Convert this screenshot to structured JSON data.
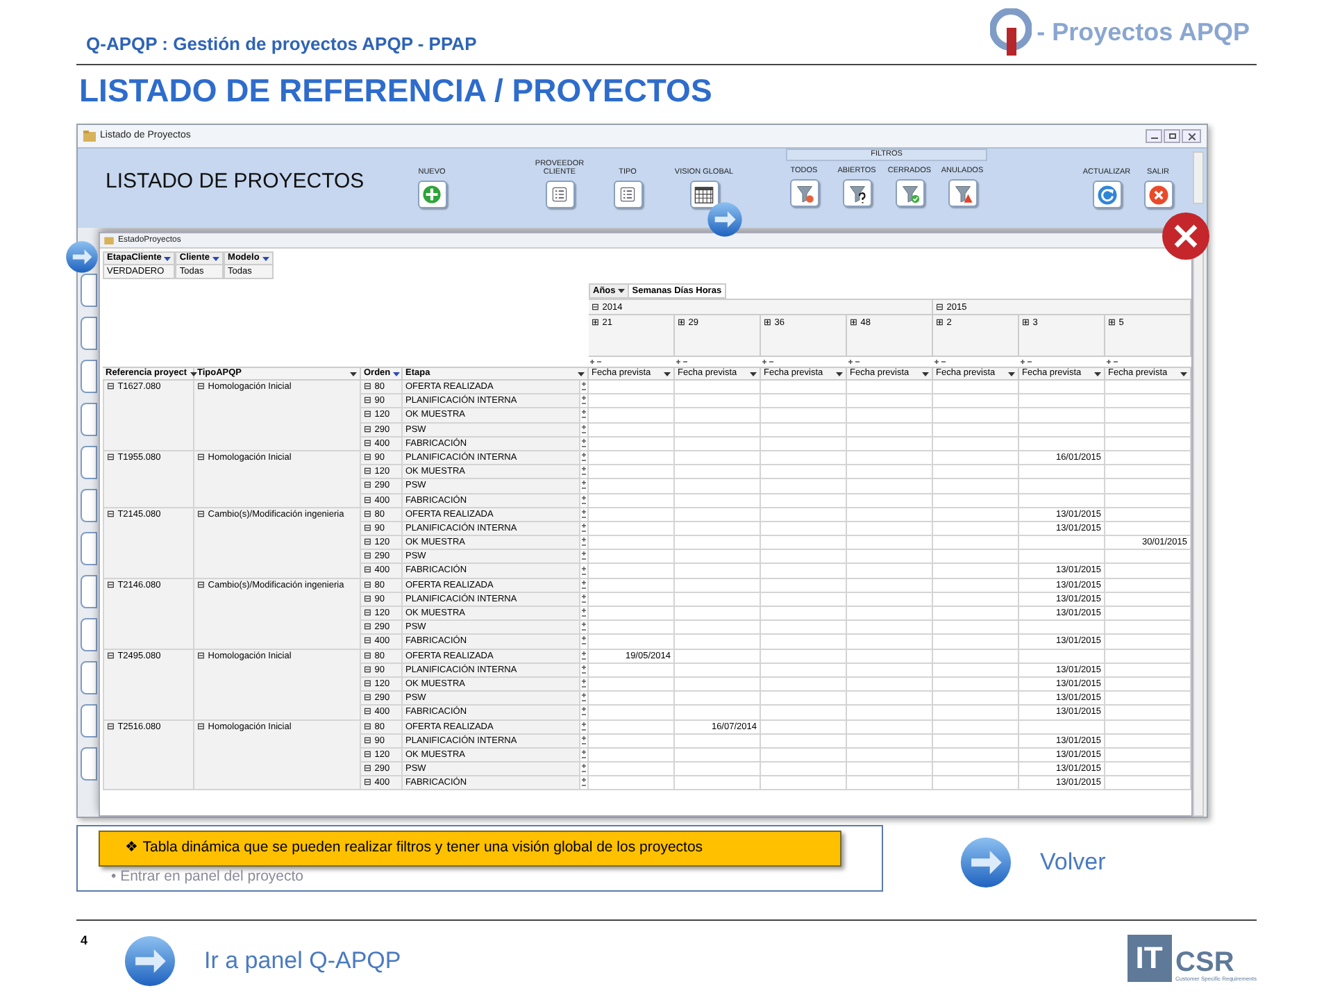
{
  "slide": {
    "header": "Q-APQP : Gestión de proyectos APQP - PPAP",
    "logo_text": "- Proyectos APQP",
    "title": "LISTADO DE REFERENCIA / PROYECTOS",
    "page_number": "4"
  },
  "window": {
    "title": "Listado de Proyectos",
    "heading": "LISTADO DE PROYECTOS",
    "toolbar": [
      {
        "label": "NUEVO",
        "kind": "add"
      },
      {
        "label": "PROVEEDOR CLIENTE",
        "kind": "list"
      },
      {
        "label": "TIPO",
        "kind": "list"
      },
      {
        "label": "VISION GLOBAL",
        "kind": "calendar"
      }
    ],
    "filters": {
      "title": "FILTROS",
      "buttons": [
        {
          "label": "TODOS",
          "kind": "filter-all"
        },
        {
          "label": "ABIERTOS",
          "kind": "filter-open"
        },
        {
          "label": "CERRADOS",
          "kind": "filter-closed"
        },
        {
          "label": "ANULADOS",
          "kind": "filter-cancelled"
        }
      ]
    },
    "right_buttons": [
      {
        "label": "ACTUALIZAR",
        "kind": "refresh"
      },
      {
        "label": "SALIR",
        "kind": "exit"
      }
    ]
  },
  "inner_window": {
    "title": "EstadoProyectos"
  },
  "pivot": {
    "page_filters": [
      {
        "label": "EtapaCliente",
        "value": "VERDADERO"
      },
      {
        "label": "Cliente",
        "value": "Todas"
      },
      {
        "label": "Modelo",
        "value": "Todas"
      }
    ],
    "time_field": "Años",
    "time_options": "Semanas Días Horas",
    "years": [
      {
        "label": "⊟ 2014",
        "weeks": [
          {
            "label": "⊞ 21",
            "value_header": "Fecha prevista"
          },
          {
            "label": "⊞ 29",
            "value_header": "Fecha prevista"
          },
          {
            "label": "⊞ 36",
            "value_header": "Fecha prevista"
          },
          {
            "label": "⊞ 48",
            "value_header": "Fecha prevista"
          }
        ]
      },
      {
        "label": "⊟ 2015",
        "weeks": [
          {
            "label": "⊞ 2",
            "value_header": "Fecha prevista"
          },
          {
            "label": "⊞ 3",
            "value_header": "Fecha prevista"
          },
          {
            "label": "⊞ 5",
            "value_header": "Fecha prevista"
          }
        ]
      }
    ],
    "row_headers": [
      "Referencia proyect",
      "TipoAPQP",
      "Orden",
      "Etapa"
    ],
    "projects": [
      {
        "ref": "⊟ T1627.080",
        "tipo": "⊟ Homologación Inicial",
        "stages": [
          {
            "orden": "⊟ 80",
            "etapa": "OFERTA REALIZADA",
            "dates": [
              {
                "kind": "blank"
              },
              {
                "kind": "blank"
              },
              {
                "kind": "blank"
              },
              {
                "kind": "blank"
              },
              {
                "kind": "blank"
              },
              {
                "kind": "blank"
              },
              {
                "kind": "blank"
              }
            ]
          },
          {
            "orden": "⊟ 90",
            "etapa": "PLANIFICACIÓN INTERNA",
            "dates": [
              {
                "kind": "blank"
              },
              {
                "kind": "blank"
              },
              {
                "kind": "blank"
              },
              {
                "kind": "blank"
              },
              {
                "kind": "blank"
              },
              {
                "kind": "blank"
              },
              {
                "kind": "blank"
              }
            ]
          },
          {
            "orden": "⊟ 120",
            "etapa": "OK MUESTRA",
            "dates": [
              {
                "kind": "blank"
              },
              {
                "kind": "blank"
              },
              {
                "kind": "blank"
              },
              {
                "kind": "blank"
              },
              {
                "kind": "blank"
              },
              {
                "kind": "blank"
              },
              {
                "kind": "blank"
              }
            ]
          },
          {
            "orden": "⊟ 290",
            "etapa": "PSW",
            "dates": [
              {
                "kind": "blank"
              },
              {
                "kind": "blank"
              },
              {
                "kind": "blank"
              },
              {
                "kind": "blank"
              },
              {
                "kind": "blank"
              },
              {
                "kind": "blank"
              },
              {
                "kind": "blank"
              }
            ]
          },
          {
            "orden": "⊟ 400",
            "etapa": "FABRICACIÓN",
            "dates": [
              {
                "kind": "blank"
              },
              {
                "kind": "blank"
              },
              {
                "kind": "blank"
              },
              {
                "kind": "blank"
              },
              {
                "kind": "blank"
              },
              {
                "kind": "blank"
              },
              {
                "kind": "blank"
              }
            ]
          }
        ]
      },
      {
        "ref": "⊟ T1955.080",
        "tipo": "⊟ Homologación Inicial",
        "stages": [
          {
            "orden": "⊟ 90",
            "etapa": "PLANIFICACIÓN INTERNA",
            "dates": [
              {
                "kind": "blank"
              },
              {
                "kind": "blank"
              },
              {
                "kind": "blank"
              },
              {
                "kind": "blank"
              },
              {
                "kind": "blank"
              },
              {
                "kind": "date",
                "text": "16/01/2015"
              },
              {
                "kind": "blank"
              }
            ]
          },
          {
            "orden": "⊟ 120",
            "etapa": "OK MUESTRA",
            "dates": [
              {
                "kind": "blank"
              },
              {
                "kind": "blank"
              },
              {
                "kind": "blank"
              },
              {
                "kind": "blank"
              },
              {
                "kind": "blank"
              },
              {
                "kind": "blank"
              },
              {
                "kind": "blank"
              }
            ]
          },
          {
            "orden": "⊟ 290",
            "etapa": "PSW",
            "dates": [
              {
                "kind": "blank"
              },
              {
                "kind": "blank"
              },
              {
                "kind": "blank"
              },
              {
                "kind": "blank"
              },
              {
                "kind": "blank"
              },
              {
                "kind": "blank"
              },
              {
                "kind": "blank"
              }
            ]
          },
          {
            "orden": "⊟ 400",
            "etapa": "FABRICACIÓN",
            "dates": [
              {
                "kind": "blank"
              },
              {
                "kind": "blank"
              },
              {
                "kind": "blank"
              },
              {
                "kind": "blank"
              },
              {
                "kind": "blank"
              },
              {
                "kind": "blank"
              },
              {
                "kind": "blank"
              }
            ]
          }
        ]
      },
      {
        "ref": "⊟ T2145.080",
        "tipo": "⊟ Cambio(s)/Modificación ingenieria",
        "stages": [
          {
            "orden": "⊟ 80",
            "etapa": "OFERTA REALIZADA",
            "dates": [
              {
                "kind": "blank"
              },
              {
                "kind": "blank"
              },
              {
                "kind": "blank"
              },
              {
                "kind": "blank"
              },
              {
                "kind": "blank"
              },
              {
                "kind": "date",
                "text": "13/01/2015"
              },
              {
                "kind": "blank"
              }
            ]
          },
          {
            "orden": "⊟ 90",
            "etapa": "PLANIFICACIÓN INTERNA",
            "dates": [
              {
                "kind": "blank"
              },
              {
                "kind": "blank"
              },
              {
                "kind": "blank"
              },
              {
                "kind": "blank"
              },
              {
                "kind": "blank"
              },
              {
                "kind": "date",
                "text": "13/01/2015"
              },
              {
                "kind": "blank"
              }
            ]
          },
          {
            "orden": "⊟ 120",
            "etapa": "OK MUESTRA",
            "dates": [
              {
                "kind": "blank"
              },
              {
                "kind": "blank"
              },
              {
                "kind": "blank"
              },
              {
                "kind": "blank"
              },
              {
                "kind": "blank"
              },
              {
                "kind": "blank"
              },
              {
                "kind": "date",
                "text": "30/01/2015"
              }
            ]
          },
          {
            "orden": "⊟ 290",
            "etapa": "PSW",
            "dates": [
              {
                "kind": "blank"
              },
              {
                "kind": "blank"
              },
              {
                "kind": "blank"
              },
              {
                "kind": "blank"
              },
              {
                "kind": "blank"
              },
              {
                "kind": "blank"
              },
              {
                "kind": "blank"
              }
            ]
          },
          {
            "orden": "⊟ 400",
            "etapa": "FABRICACIÓN",
            "dates": [
              {
                "kind": "blank"
              },
              {
                "kind": "blank"
              },
              {
                "kind": "blank"
              },
              {
                "kind": "blank"
              },
              {
                "kind": "blank"
              },
              {
                "kind": "date",
                "text": "13/01/2015"
              },
              {
                "kind": "blank"
              }
            ]
          }
        ]
      },
      {
        "ref": "⊟ T2146.080",
        "tipo": "⊟ Cambio(s)/Modificación ingenieria",
        "stages": [
          {
            "orden": "⊟ 80",
            "etapa": "OFERTA REALIZADA",
            "dates": [
              {
                "kind": "blank"
              },
              {
                "kind": "blank"
              },
              {
                "kind": "blank"
              },
              {
                "kind": "blank"
              },
              {
                "kind": "blank"
              },
              {
                "kind": "date",
                "text": "13/01/2015"
              },
              {
                "kind": "blank"
              }
            ]
          },
          {
            "orden": "⊟ 90",
            "etapa": "PLANIFICACIÓN INTERNA",
            "dates": [
              {
                "kind": "blank"
              },
              {
                "kind": "blank"
              },
              {
                "kind": "blank"
              },
              {
                "kind": "blank"
              },
              {
                "kind": "blank"
              },
              {
                "kind": "date",
                "text": "13/01/2015"
              },
              {
                "kind": "blank"
              }
            ]
          },
          {
            "orden": "⊟ 120",
            "etapa": "OK MUESTRA",
            "dates": [
              {
                "kind": "blank"
              },
              {
                "kind": "blank"
              },
              {
                "kind": "blank"
              },
              {
                "kind": "blank"
              },
              {
                "kind": "blank"
              },
              {
                "kind": "date",
                "text": "13/01/2015"
              },
              {
                "kind": "blank"
              }
            ]
          },
          {
            "orden": "⊟ 290",
            "etapa": "PSW",
            "dates": [
              {
                "kind": "blank"
              },
              {
                "kind": "blank"
              },
              {
                "kind": "blank"
              },
              {
                "kind": "blank"
              },
              {
                "kind": "blank"
              },
              {
                "kind": "blank"
              },
              {
                "kind": "blank"
              }
            ]
          },
          {
            "orden": "⊟ 400",
            "etapa": "FABRICACIÓN",
            "dates": [
              {
                "kind": "blank"
              },
              {
                "kind": "blank"
              },
              {
                "kind": "blank"
              },
              {
                "kind": "blank"
              },
              {
                "kind": "blank"
              },
              {
                "kind": "date",
                "text": "13/01/2015"
              },
              {
                "kind": "blank"
              }
            ]
          }
        ]
      },
      {
        "ref": "⊟ T2495.080",
        "tipo": "⊟ Homologación Inicial",
        "stages": [
          {
            "orden": "⊟ 80",
            "etapa": "OFERTA REALIZADA",
            "dates": [
              {
                "kind": "date",
                "text": "19/05/2014"
              },
              {
                "kind": "blank"
              },
              {
                "kind": "blank"
              },
              {
                "kind": "blank"
              },
              {
                "kind": "blank"
              },
              {
                "kind": "blank"
              },
              {
                "kind": "blank"
              }
            ]
          },
          {
            "orden": "⊟ 90",
            "etapa": "PLANIFICACIÓN INTERNA",
            "dates": [
              {
                "kind": "blank"
              },
              {
                "kind": "blank"
              },
              {
                "kind": "blank"
              },
              {
                "kind": "blank"
              },
              {
                "kind": "blank"
              },
              {
                "kind": "date",
                "text": "13/01/2015"
              },
              {
                "kind": "blank"
              }
            ]
          },
          {
            "orden": "⊟ 120",
            "etapa": "OK MUESTRA",
            "dates": [
              {
                "kind": "blank"
              },
              {
                "kind": "blank"
              },
              {
                "kind": "blank"
              },
              {
                "kind": "blank"
              },
              {
                "kind": "blank"
              },
              {
                "kind": "date",
                "text": "13/01/2015"
              },
              {
                "kind": "blank"
              }
            ]
          },
          {
            "orden": "⊟ 290",
            "etapa": "PSW",
            "dates": [
              {
                "kind": "blank"
              },
              {
                "kind": "blank"
              },
              {
                "kind": "blank"
              },
              {
                "kind": "blank"
              },
              {
                "kind": "blank"
              },
              {
                "kind": "date",
                "text": "13/01/2015"
              },
              {
                "kind": "blank"
              }
            ]
          },
          {
            "orden": "⊟ 400",
            "etapa": "FABRICACIÓN",
            "dates": [
              {
                "kind": "blank"
              },
              {
                "kind": "blank"
              },
              {
                "kind": "blank"
              },
              {
                "kind": "blank"
              },
              {
                "kind": "blank"
              },
              {
                "kind": "date",
                "text": "13/01/2015"
              },
              {
                "kind": "blank"
              }
            ]
          }
        ]
      },
      {
        "ref": "⊟ T2516.080",
        "tipo": "⊟ Homologación Inicial",
        "stages": [
          {
            "orden": "⊟ 80",
            "etapa": "OFERTA REALIZADA",
            "dates": [
              {
                "kind": "blank"
              },
              {
                "kind": "date",
                "text": "16/07/2014"
              },
              {
                "kind": "blank"
              },
              {
                "kind": "blank"
              },
              {
                "kind": "blank"
              },
              {
                "kind": "blank"
              },
              {
                "kind": "blank"
              }
            ]
          },
          {
            "orden": "⊟ 90",
            "etapa": "PLANIFICACIÓN INTERNA",
            "dates": [
              {
                "kind": "blank"
              },
              {
                "kind": "blank"
              },
              {
                "kind": "blank"
              },
              {
                "kind": "blank"
              },
              {
                "kind": "blank"
              },
              {
                "kind": "date",
                "text": "13/01/2015"
              },
              {
                "kind": "blank"
              }
            ]
          },
          {
            "orden": "⊟ 120",
            "etapa": "OK MUESTRA",
            "dates": [
              {
                "kind": "blank"
              },
              {
                "kind": "blank"
              },
              {
                "kind": "blank"
              },
              {
                "kind": "blank"
              },
              {
                "kind": "blank"
              },
              {
                "kind": "date",
                "text": "13/01/2015"
              },
              {
                "kind": "blank"
              }
            ]
          },
          {
            "orden": "⊟ 290",
            "etapa": "PSW",
            "dates": [
              {
                "kind": "blank"
              },
              {
                "kind": "blank"
              },
              {
                "kind": "blank"
              },
              {
                "kind": "blank"
              },
              {
                "kind": "blank"
              },
              {
                "kind": "date",
                "text": "13/01/2015"
              },
              {
                "kind": "blank"
              }
            ]
          },
          {
            "orden": "⊟ 400",
            "etapa": "FABRICACIÓN",
            "dates": [
              {
                "kind": "blank"
              },
              {
                "kind": "blank"
              },
              {
                "kind": "blank"
              },
              {
                "kind": "blank"
              },
              {
                "kind": "blank"
              },
              {
                "kind": "date",
                "text": "13/01/2015"
              },
              {
                "kind": "blank"
              }
            ]
          }
        ]
      }
    ]
  },
  "notes": {
    "callout": "❖ Tabla dinámica que se pueden realizar filtros y tener una visión global de los proyectos",
    "bullet": "• Entrar en panel del proyecto"
  },
  "links": {
    "back": "Volver",
    "panel": "Ir a panel Q-APQP"
  },
  "footer_logo": {
    "it": "IT",
    "csr": "CSR",
    "tagline": "Customer Specific Requirements"
  }
}
